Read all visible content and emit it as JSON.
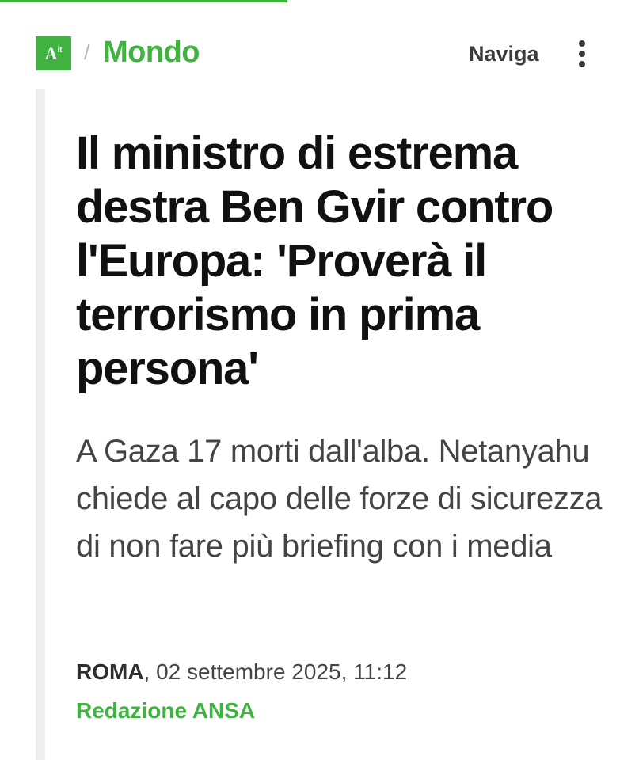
{
  "progress": {
    "fraction": 0.45,
    "color": "#3fb23f"
  },
  "header": {
    "logo_text_main": "A",
    "logo_text_sup": "it",
    "separator": "/",
    "section": "Mondo",
    "nav_label": "Naviga",
    "menu_icon": "more-vertical-icon"
  },
  "article": {
    "headline": "Il ministro di estrema destra Ben Gvir contro l'Europa: 'Proverà il terrorismo in prima persona'",
    "subtitle": "A Gaza 17 morti dall'alba. Netanyahu chiede al capo delle forze di sicurezza di non fare più briefing con i media",
    "city": "ROMA",
    "dateline": ", 02 settembre 2025, 11:12",
    "author": "Redazione ANSA"
  },
  "colors": {
    "brand_green": "#3fb23f",
    "headline": "#111111",
    "body_text": "#444444"
  }
}
